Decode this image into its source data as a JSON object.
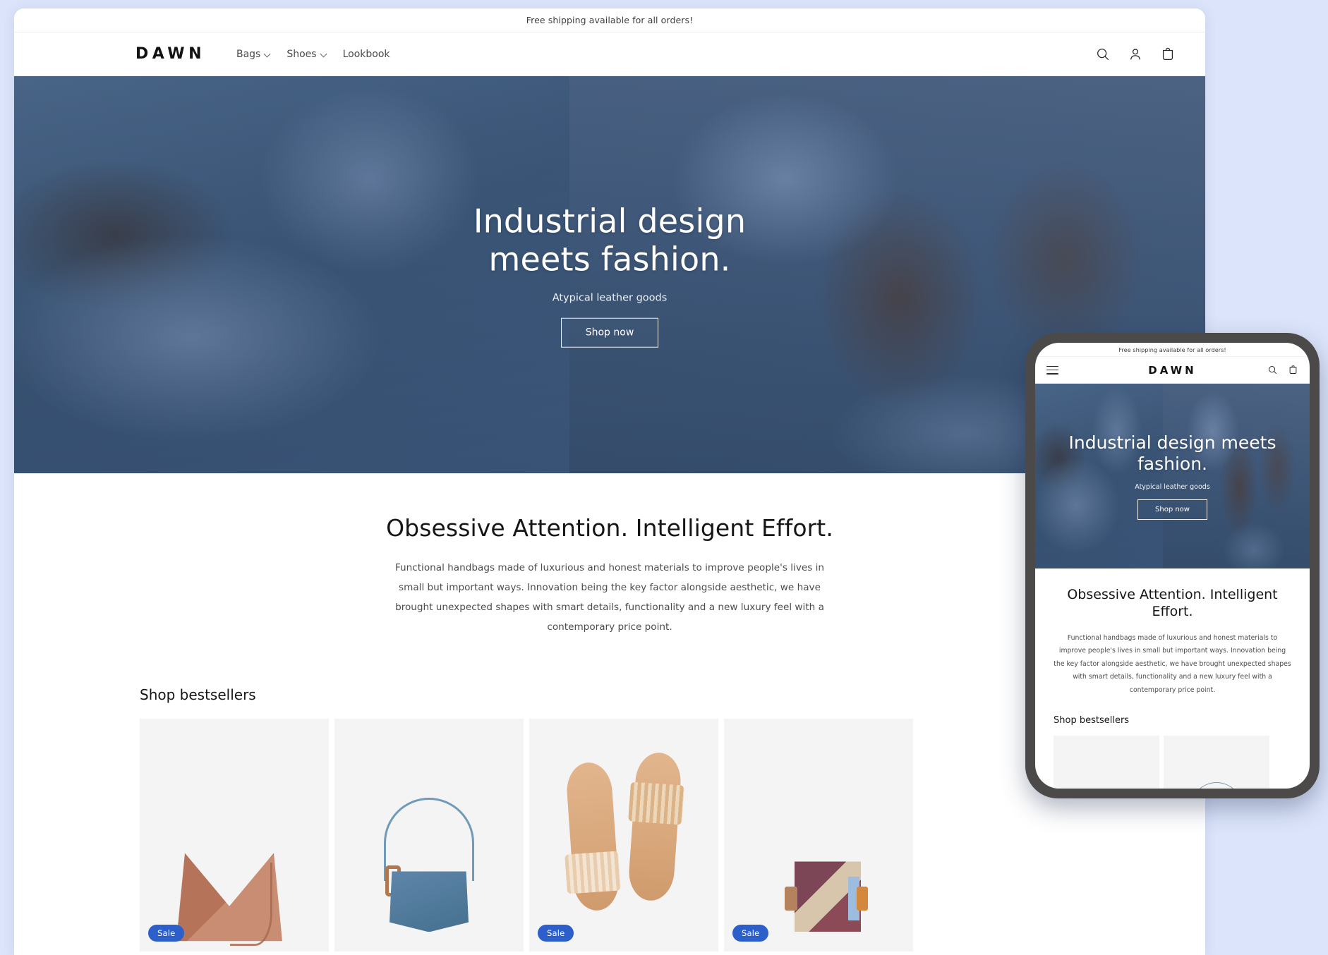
{
  "theme": {
    "page_background": "#dbe4fa",
    "accent_badge": "#2c5fc9",
    "hero_blue": "#3f5a7b",
    "text_dark": "#161616",
    "text_muted": "#4c4c4c"
  },
  "desktop": {
    "announcement": "Free shipping available for all orders!",
    "header": {
      "brand": "DAWN",
      "nav": [
        {
          "label": "Bags",
          "has_dropdown": true
        },
        {
          "label": "Shoes",
          "has_dropdown": true
        },
        {
          "label": "Lookbook",
          "has_dropdown": false
        }
      ],
      "icons": [
        "search-icon",
        "account-icon",
        "cart-icon"
      ]
    },
    "hero": {
      "title_line1": "Industrial design",
      "title_line2": "meets fashion.",
      "subtitle": "Atypical leather goods",
      "button": "Shop now"
    },
    "richtext": {
      "title": "Obsessive Attention. Intelligent Effort.",
      "body": "Functional handbags made of luxurious and honest materials to improve people's lives in small but important ways. Innovation being the key factor alongside aesthetic, we have brought unexpected shapes with smart details, functionality and a new luxury feel with a contemporary price point."
    },
    "collection": {
      "title": "Shop bestsellers",
      "products": [
        {
          "name": "tan-origami-bag",
          "badge": "Sale"
        },
        {
          "name": "blue-shoulder-bag",
          "badge": ""
        },
        {
          "name": "tan-pleated-sandals",
          "badge": "Sale"
        },
        {
          "name": "colorblock-bag",
          "badge": "Sale"
        }
      ]
    }
  },
  "mobile": {
    "announcement": "Free shipping available for all orders!",
    "header": {
      "brand": "DAWN",
      "icons": [
        "menu-icon",
        "search-icon",
        "cart-icon"
      ]
    },
    "hero": {
      "title": "Industrial design meets fashion.",
      "subtitle": "Atypical leather goods",
      "button": "Shop now"
    },
    "richtext": {
      "title": "Obsessive Attention. Intelligent Effort.",
      "body": "Functional handbags made of luxurious and honest materials to improve people's lives in small but important ways. Innovation being the key factor alongside aesthetic, we have brought unexpected shapes with smart details, functionality and a new luxury feel with a contemporary price point."
    },
    "collection": {
      "title": "Shop bestsellers",
      "products": [
        {
          "name": "product-placeholder-1"
        },
        {
          "name": "product-placeholder-2"
        }
      ]
    }
  }
}
